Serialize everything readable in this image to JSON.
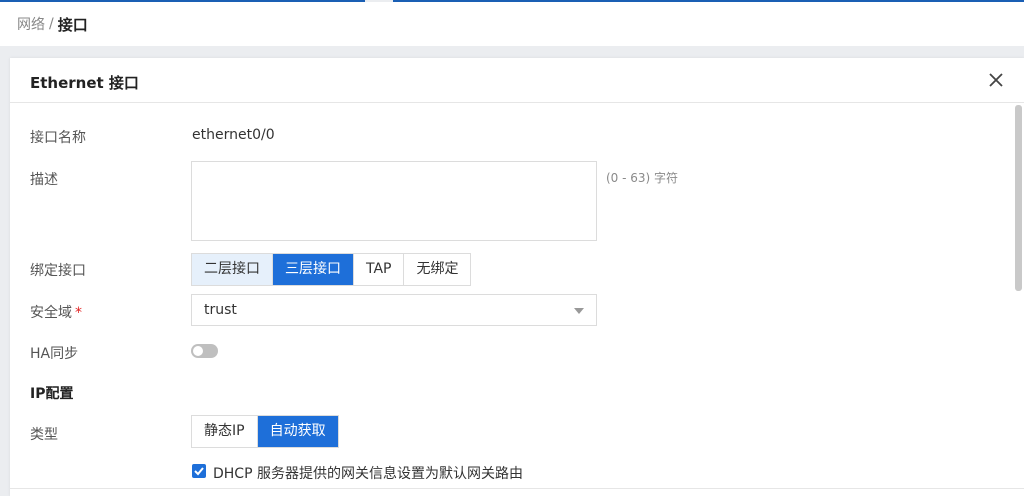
{
  "breadcrumb": {
    "parent": "网络",
    "separator": "/",
    "current": "接口"
  },
  "dialog": {
    "title": "Ethernet 接口",
    "close_icon": "close-icon"
  },
  "form": {
    "name_label": "接口名称",
    "name_value": "ethernet0/0",
    "desc_label": "描述",
    "desc_value": "",
    "desc_hint": "(0 - 63) 字符",
    "bind_label": "绑定接口",
    "bind_options": [
      "二层接口",
      "三层接口",
      "TAP",
      "无绑定"
    ],
    "bind_selected": "三层接口",
    "zone_label": "安全域",
    "zone_required": "*",
    "zone_value": "trust",
    "ha_label": "HA同步",
    "ha_enabled": false,
    "ip_section": "IP配置",
    "type_label": "类型",
    "type_options": [
      "静态IP",
      "自动获取"
    ],
    "type_selected": "自动获取",
    "dhcp_checked": true,
    "dhcp_label": "DHCP 服务器提供的网关信息设置为默认网关路由"
  },
  "colors": {
    "accent": "#1e6fd9",
    "light_accent": "#e6f0fb",
    "required": "#e02020"
  }
}
